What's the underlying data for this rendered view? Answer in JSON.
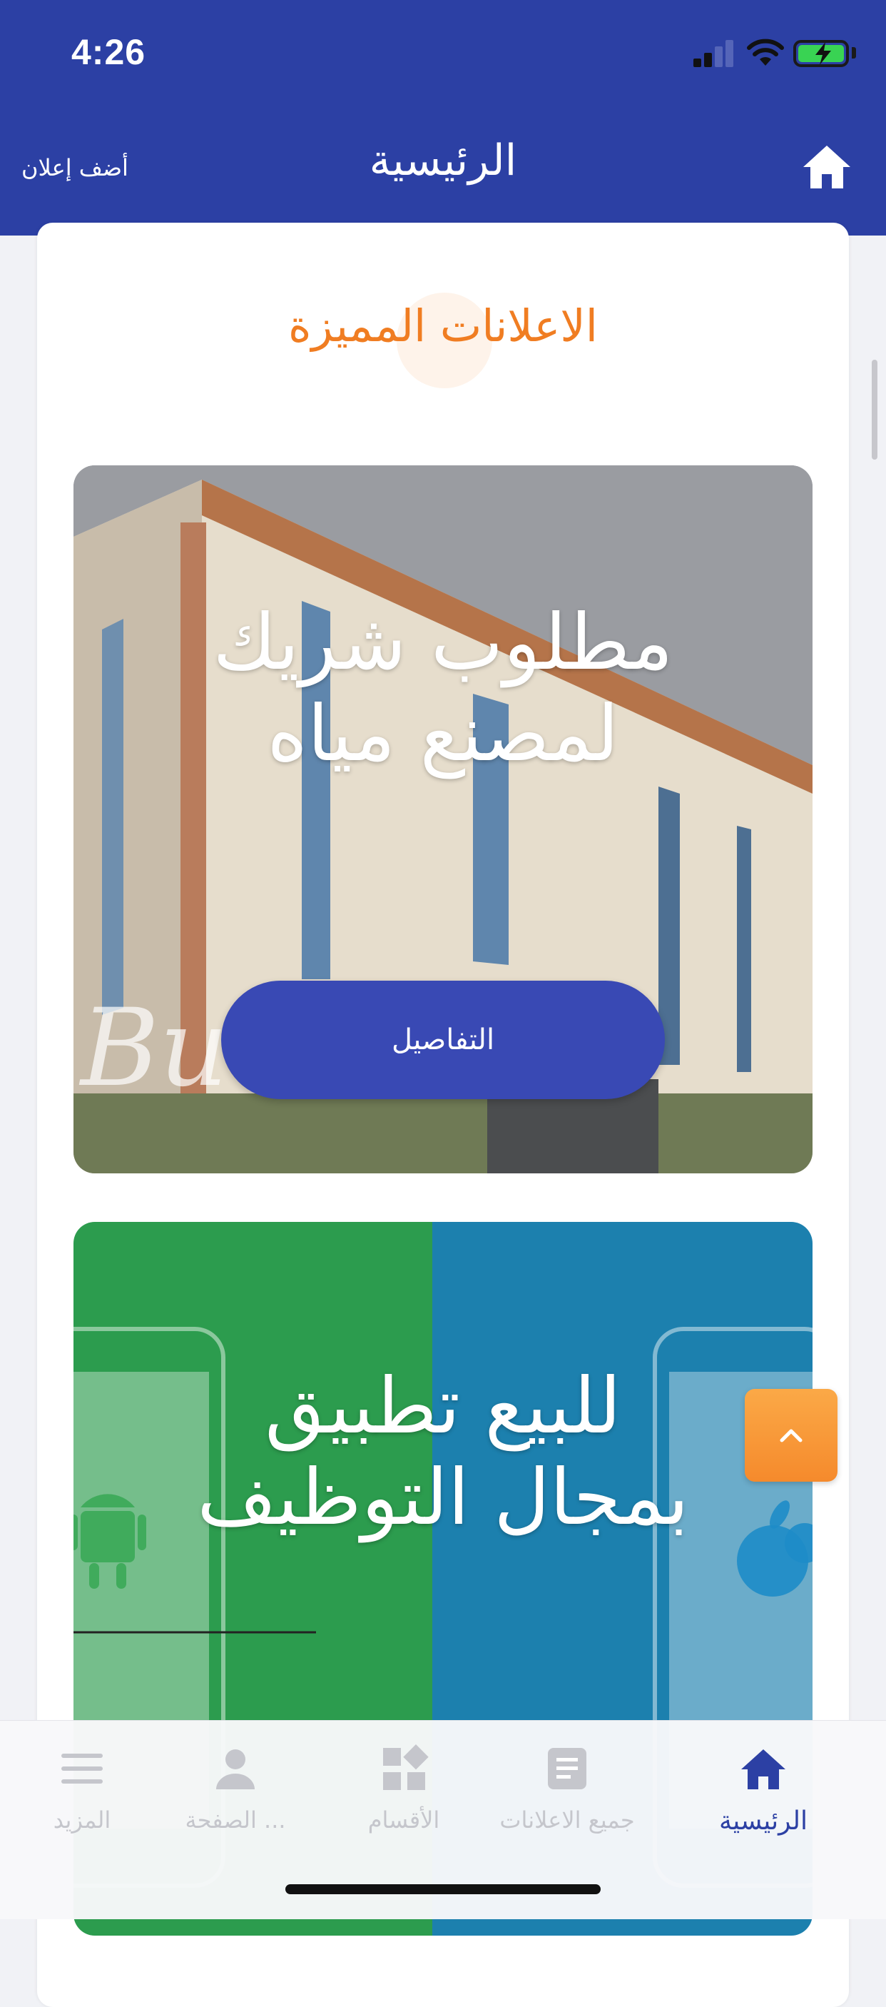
{
  "status_bar": {
    "time": "4:26"
  },
  "header": {
    "title": "الرئيسية",
    "add_ad_label": "أضف إعلان",
    "home_icon": "home-icon"
  },
  "section": {
    "title": "الاعلانات المميزة"
  },
  "ads": [
    {
      "headline_line1": "مطلوب شريك",
      "headline_line2": "لمصنع مياه",
      "details_label": "التفاصيل"
    },
    {
      "headline_line1": "للبيع تطبيق",
      "headline_line2": "بمجال التوظيف"
    }
  ],
  "tabbar": {
    "items": [
      {
        "label": "الرئيسية",
        "icon": "home-icon",
        "active": true
      },
      {
        "label": "جميع الاعلانات",
        "icon": "document-icon",
        "active": false
      },
      {
        "label": "الأقسام",
        "icon": "categories-icon",
        "active": false
      },
      {
        "label": "الصفحة ...",
        "icon": "profile-icon",
        "active": false
      },
      {
        "label": "المزيد",
        "icon": "menu-icon",
        "active": false
      }
    ]
  },
  "colors": {
    "primary": "#2c40a4",
    "accent": "#f07d22",
    "button": "#3949b4",
    "inactive": "#c5c6cc"
  }
}
